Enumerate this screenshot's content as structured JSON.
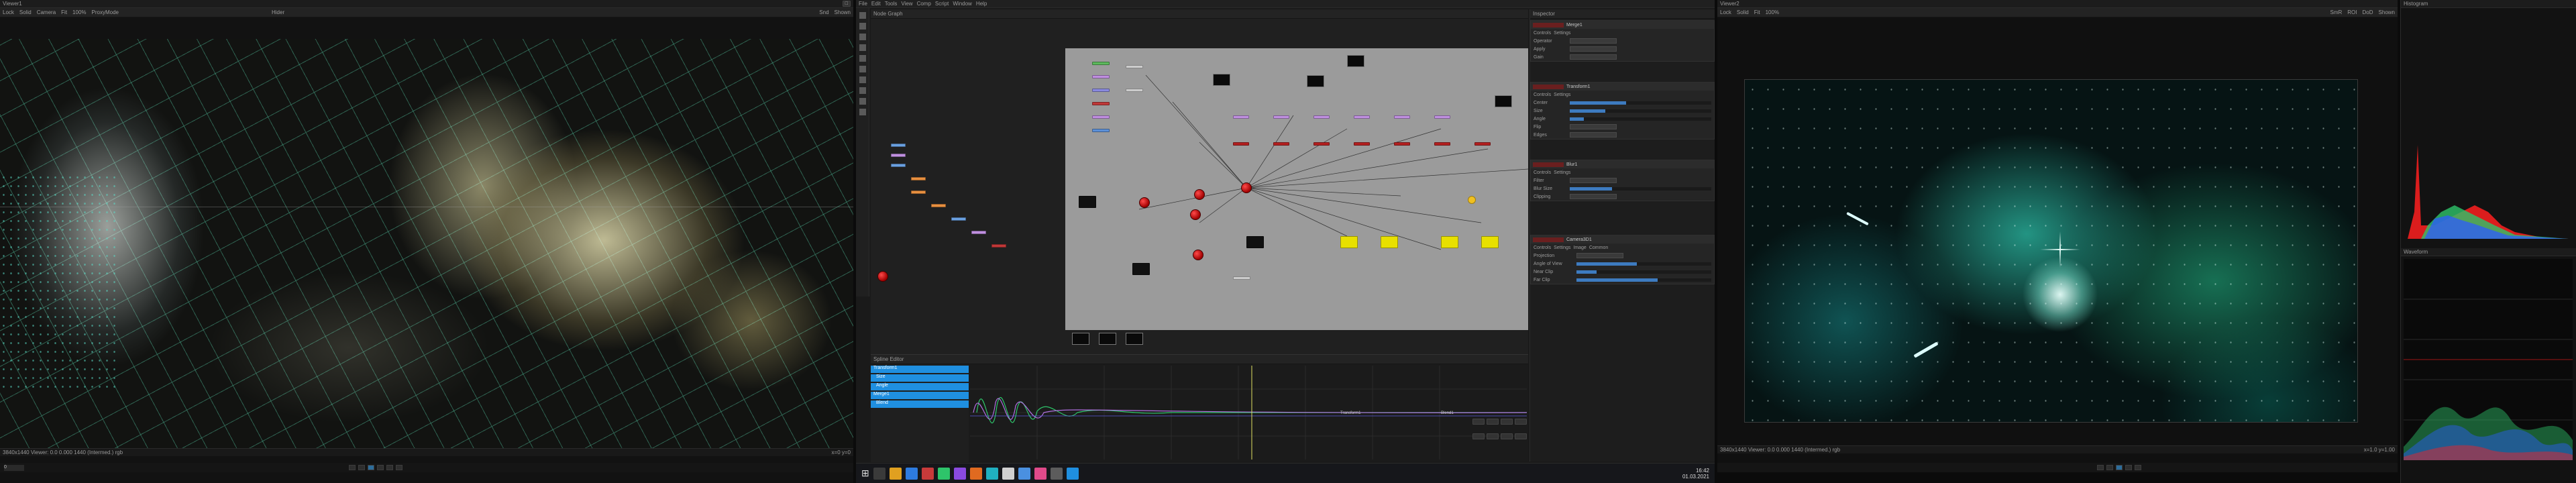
{
  "left_viewer": {
    "title": "Viewer1",
    "toolbar": [
      "Lock",
      "Solid",
      "Camera",
      "Fit",
      "100%",
      "ProxyMode",
      "Hider",
      "Snd",
      "Shown"
    ],
    "status_left": "3840x1440  Viewer: 0.0  0.000  1440  (Intermed.) rgb",
    "status_right": "x=0  y=0",
    "frame_label": "0",
    "colors": {
      "grid": "#46c8a0",
      "nebula": "#dcd7aa"
    }
  },
  "center": {
    "menu": [
      "File",
      "Edit",
      "Tools",
      "View",
      "Comp",
      "Script",
      "Window",
      "Help"
    ],
    "node_editor_title": "Node Graph",
    "inspector_title": "Inspector",
    "inspector_sections": [
      {
        "name": "Merge1",
        "tabs": [
          "Controls",
          "Settings"
        ],
        "rows": [
          "Operator",
          "Apply",
          "Gain"
        ]
      },
      {
        "name": "Transform1",
        "tabs": [
          "Controls",
          "Settings"
        ],
        "rows": [
          "Center",
          "Size",
          "Angle",
          "Flip",
          "Edges"
        ]
      },
      {
        "name": "Blur1",
        "tabs": [
          "Controls",
          "Settings"
        ],
        "rows": [
          "Filter",
          "Blur Size",
          "Clipping"
        ]
      },
      {
        "name": "Camera3D1",
        "tabs": [
          "Controls",
          "Settings",
          "Image",
          "Common"
        ],
        "rows": [
          "Projection",
          "Angle of View",
          "Near Clip",
          "Far Clip"
        ]
      }
    ],
    "spline_editor_title": "Spline Editor",
    "spline_list": [
      "Transform1",
      "Size",
      "Angle",
      "Merge1",
      "Blend"
    ],
    "keyframe_labels": [
      "Transform1",
      "Blend1"
    ],
    "colors": {
      "graph_bg": "#9b9b9b",
      "selected_row": "#1f8fe0",
      "key_node": "#d10000"
    }
  },
  "right_viewer": {
    "title": "Viewer2",
    "toolbar": [
      "Lock",
      "Solid",
      "Fit",
      "100%",
      "SmR",
      "ROI",
      "DoD",
      "Shown"
    ],
    "status_left": "3840x1440  Viewer: 0.0  0.000  1440  (Intermed.) rgb",
    "status_right": "x=1.0  y=1.00",
    "colors": {
      "nebula": "#1ea090",
      "star": "#e6fffa"
    }
  },
  "scopes": {
    "histogram_title": "Histogram",
    "waveform_title": "Waveform",
    "colors": {
      "red": "#ff2020",
      "green": "#2ec46a",
      "blue": "#2d5bff"
    }
  },
  "taskbar": {
    "time": "16:42",
    "date": "01.03.2021"
  }
}
